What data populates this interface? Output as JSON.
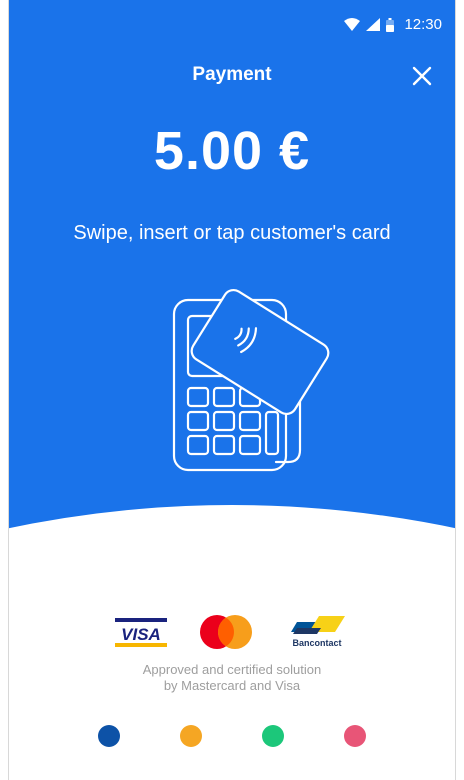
{
  "status_bar": {
    "time": "12:30",
    "icons": [
      "wifi-icon",
      "signal-icon",
      "battery-icon"
    ]
  },
  "header": {
    "title": "Payment",
    "close_icon": "close-icon"
  },
  "payment": {
    "amount": "5.00 €",
    "instruction": "Swipe, insert or tap customer's card"
  },
  "illustration": {
    "name": "card-terminal-illustration"
  },
  "card_logos": [
    {
      "name": "visa-logo",
      "text": "VISA"
    },
    {
      "name": "mastercard-logo",
      "text": ""
    },
    {
      "name": "bancontact-logo",
      "text": "Bancontact"
    }
  ],
  "approval": {
    "line1": "Approved and certified solution",
    "line2": "by Mastercard and Visa"
  },
  "dots": [
    {
      "name": "dot-blue",
      "color": "#0d52a7"
    },
    {
      "name": "dot-orange",
      "color": "#f5a623"
    },
    {
      "name": "dot-green",
      "color": "#1cc77a"
    },
    {
      "name": "dot-pink",
      "color": "#e85577"
    }
  ],
  "colors": {
    "primary": "#1a73ea",
    "background": "#ffffff",
    "muted_text": "#9e9e9e"
  }
}
